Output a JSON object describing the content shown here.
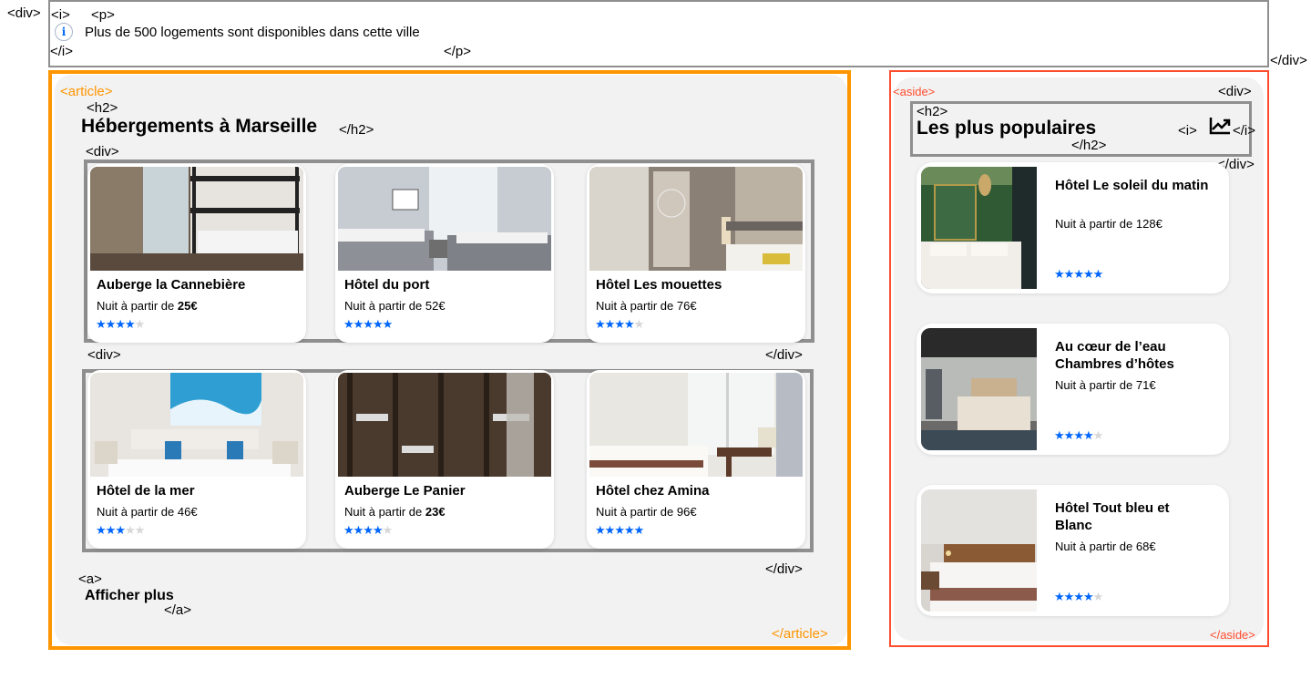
{
  "info": {
    "icon": "info-icon",
    "glyph": "i",
    "text": "Plus de 500 logements sont disponibles dans cette ville"
  },
  "tags": {
    "div_open": "<div>",
    "div_close": "</div>",
    "i_open": "<i>",
    "i_close": "</i>",
    "p_open": "<p>",
    "p_close": "</p>",
    "article_open": "<article>",
    "article_close": "</article>",
    "h2_open": "<h2>",
    "h2_close": "</h2>",
    "a_open": "<a>",
    "a_close": "</a>",
    "aside_open": "<aside>",
    "aside_close": "</aside>"
  },
  "article": {
    "title": "Hébergements à Marseille",
    "show_more": "Afficher plus",
    "rows": [
      [
        {
          "name": "Auberge la Cannebière",
          "price_prefix": "Nuit à partir de ",
          "price": "25€",
          "bold_price": true,
          "rating": 4,
          "photo": "bunk-room-window"
        },
        {
          "name": "Hôtel du port",
          "price_prefix": "Nuit à partir de ",
          "price": "52€",
          "bold_price": false,
          "rating": 5,
          "photo": "twin-beds-grey-room"
        },
        {
          "name": "Hôtel Les mouettes",
          "price_prefix": "Nuit à partir de ",
          "price": "76€",
          "bold_price": false,
          "rating": 4,
          "photo": "bedroom-mirror-wardrobe"
        }
      ],
      [
        {
          "name": "Hôtel de la mer",
          "price_prefix": "Nuit à partir de ",
          "price": "46€",
          "bold_price": false,
          "rating": 3,
          "photo": "white-bedroom-sea-painting"
        },
        {
          "name": "Auberge Le Panier",
          "price_prefix": "Nuit à partir de ",
          "price": "23€",
          "bold_price": true,
          "rating": 4,
          "photo": "wooden-bunks-dorm"
        },
        {
          "name": "Hôtel chez Amina",
          "price_prefix": "Nuit à partir de ",
          "price": "96€",
          "bold_price": false,
          "rating": 5,
          "photo": "bright-bedroom-desk"
        }
      ]
    ]
  },
  "aside": {
    "title": "Les plus populaires",
    "icon": "trending-up-icon",
    "items": [
      {
        "name": "Hôtel Le soleil du matin",
        "price_prefix": "Nuit à partir de ",
        "price": "128€",
        "rating": 5,
        "photo": "green-wall-bedroom"
      },
      {
        "name": "Au cœur de l’eau Chambres d’hôtes",
        "price_prefix": "Nuit à partir de ",
        "price": "71€",
        "rating": 4,
        "photo": "beige-bedroom-loft"
      },
      {
        "name": "Hôtel Tout bleu et Blanc",
        "price_prefix": "Nuit à partir de ",
        "price": "68€",
        "rating": 4,
        "photo": "hotel-bed-wood-headboard"
      }
    ]
  },
  "colors": {
    "accent_blue": "#0065fc",
    "article_outline": "#ff9500",
    "aside_outline": "#ff4d2e",
    "div_outline": "#8f8f8f",
    "panel_bg": "#f2f2f2"
  },
  "max_rating": 5
}
